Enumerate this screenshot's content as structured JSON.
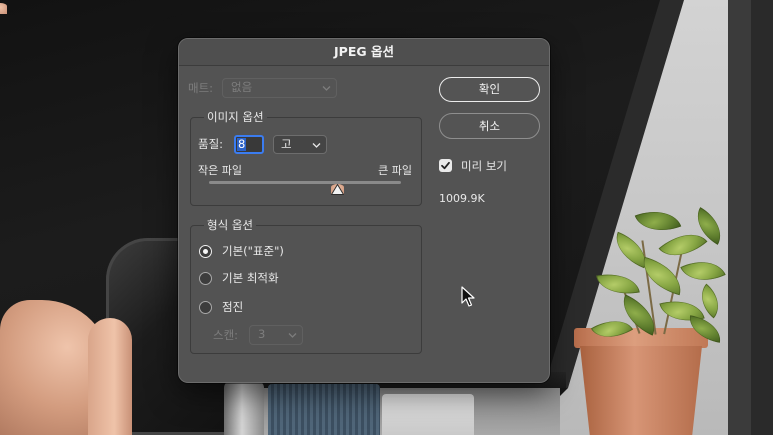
{
  "colors": {
    "dialog_bg": "#535353",
    "accent": "#3b7cf0",
    "text": "#e8e8e8",
    "disabled_text": "#7d7d7d"
  },
  "dialog": {
    "title": "JPEG 옵션",
    "matte": {
      "label": "매트:",
      "value": "없음",
      "enabled": false
    },
    "image_options": {
      "legend": "이미지 옵션",
      "quality_label": "품질:",
      "quality_value": "8",
      "quality_preset": "고",
      "small_file_label": "작은 파일",
      "large_file_label": "큰 파일",
      "quality_slider_fraction": 0.667
    },
    "format_options": {
      "legend": "형식 옵션",
      "choices": [
        {
          "label": "기본(\"표준\")",
          "selected": true
        },
        {
          "label": "기본 최적화",
          "selected": false
        },
        {
          "label": "점진",
          "selected": false
        }
      ],
      "scans": {
        "label": "스캔:",
        "value": "3",
        "enabled": false
      }
    },
    "ok_label": "확인",
    "cancel_label": "취소",
    "preview": {
      "label": "미리 보기",
      "checked": true
    },
    "file_size": "1009.9K"
  },
  "icons": {
    "dropdown": "chevron-down-icon",
    "slider_thumb": "triangle-up-icon",
    "checkbox": "checkmark-icon",
    "pointer": "mouse-cursor-icon"
  }
}
